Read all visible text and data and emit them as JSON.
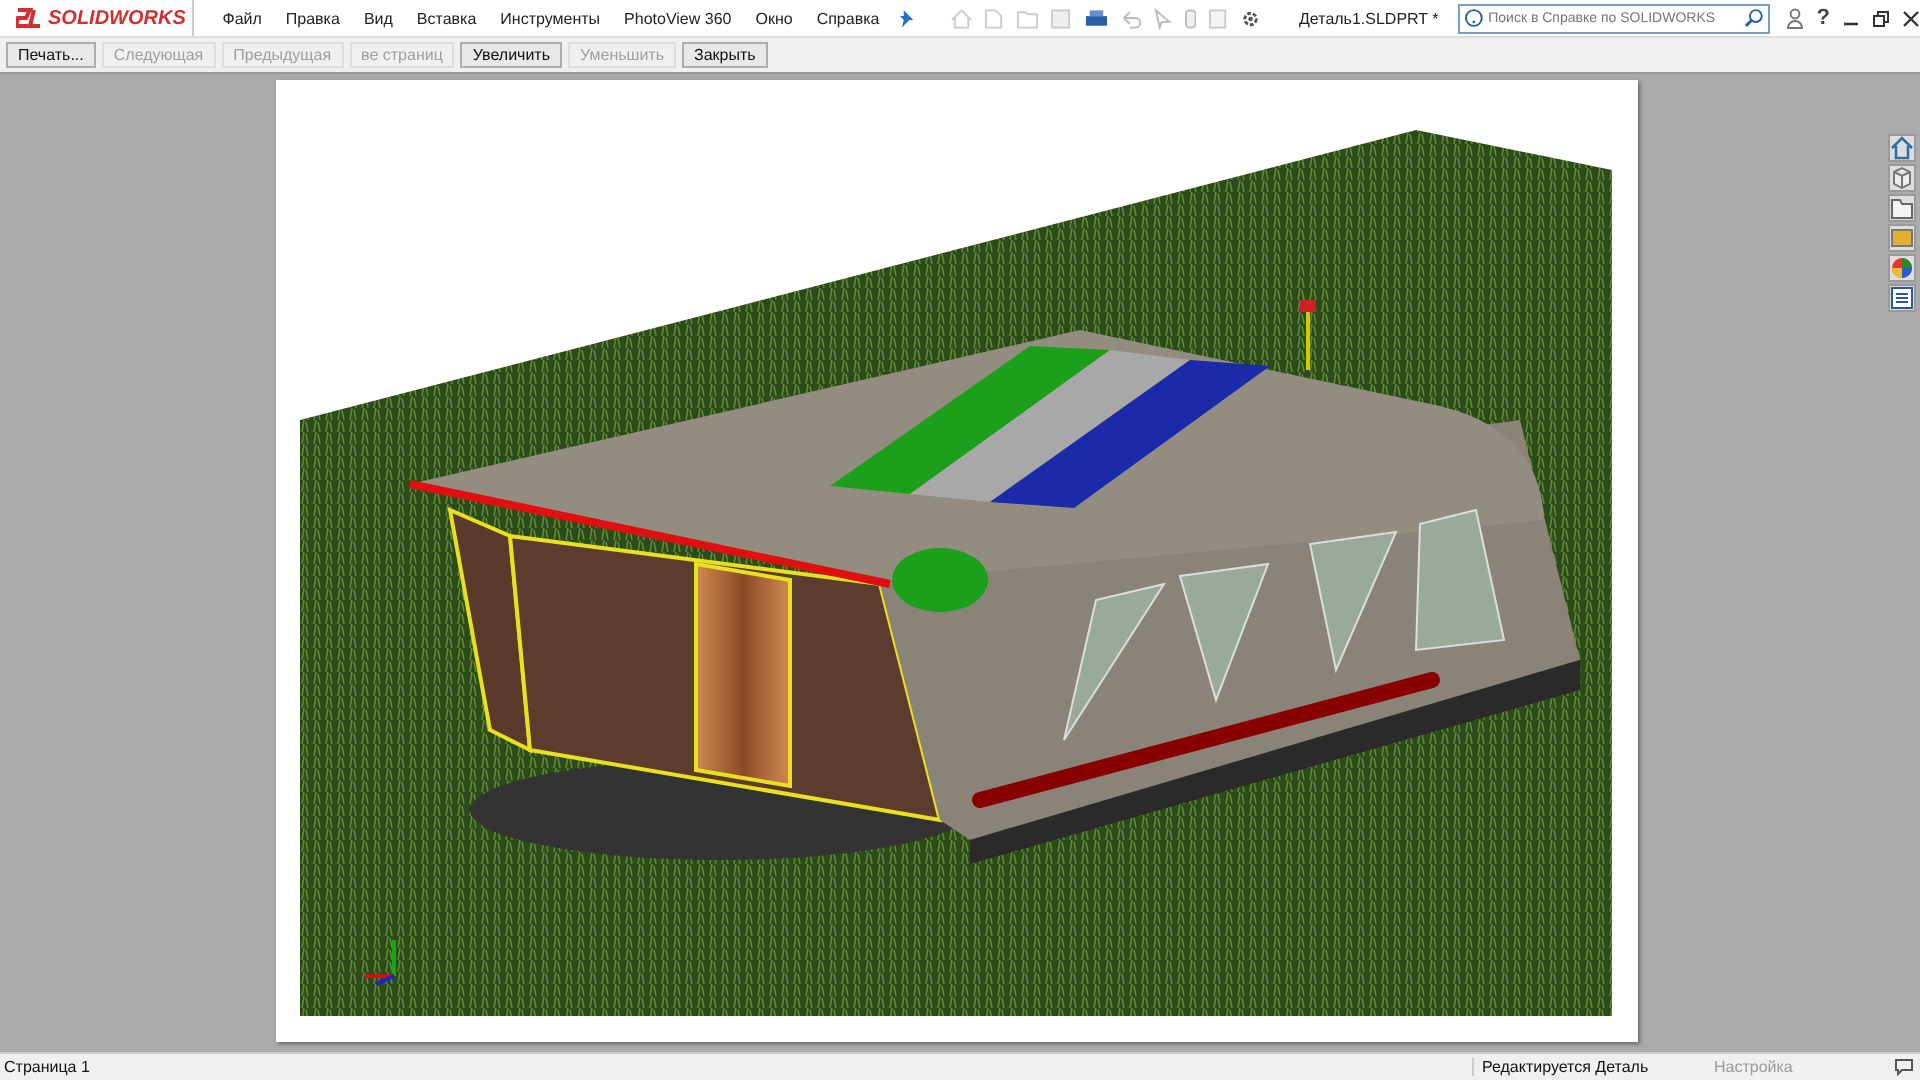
{
  "app": {
    "logo": "SOLIDWORKS",
    "menu": [
      "Файл",
      "Правка",
      "Вид",
      "Вставка",
      "Инструменты",
      "PhotoView 360",
      "Окно",
      "Справка"
    ],
    "document_title": "Деталь1.SLDPRT *",
    "search": {
      "placeholder": "Поиск в Справке по SOLIDWORKS"
    },
    "help": "?"
  },
  "print_preview_toolbar": [
    {
      "label": "Печать...",
      "disabled": false
    },
    {
      "label": "Следующая",
      "disabled": true
    },
    {
      "label": "Предыдущая",
      "disabled": true
    },
    {
      "label": "ве страниц",
      "disabled": true
    },
    {
      "label": "Увеличить",
      "disabled": false
    },
    {
      "label": "Уменьшить",
      "disabled": true
    },
    {
      "label": "Закрыть",
      "disabled": false
    }
  ],
  "status_bar": {
    "page": "Страница 1",
    "mode": "Редактируется Деталь",
    "settings": "Настройка"
  }
}
